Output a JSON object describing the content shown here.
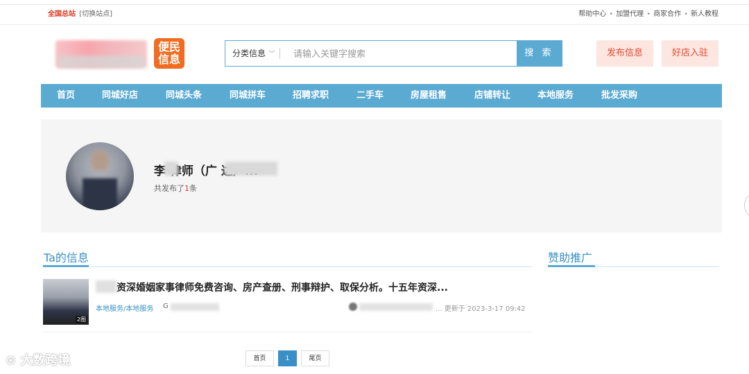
{
  "topbar": {
    "site": "全国总站",
    "switch": "[切换站点]",
    "links": [
      "帮助中心",
      "加盟代理",
      "商家合作",
      "新人教程"
    ]
  },
  "logo": {
    "badge_text": "便民信息"
  },
  "search": {
    "category": "分类信息",
    "placeholder": "请输入关键字搜索",
    "button": "搜 索"
  },
  "actions": {
    "publish": "发布信息",
    "join": "好店入驻"
  },
  "nav": [
    "首页",
    "同城好店",
    "同城头条",
    "同城拼车",
    "招聘求职",
    "二手车",
    "房屋租售",
    "店铺转让",
    "本地服务",
    "批发采购"
  ],
  "profile": {
    "name": "李  律师（广      达）...",
    "count_prefix": "共发布了",
    "count": "1",
    "count_suffix": "条"
  },
  "sections": {
    "my_info": "Ta的信息",
    "sponsor": "赞助推广"
  },
  "post": {
    "title": "资深婚姻家事律师免费咨询、房产查册、刑事辩护、取保分析。十五年资深...",
    "category": "本地服务/本地服务",
    "g_prefix": "G",
    "thumb_badge": "2图",
    "updated": "... 更新于 2023-3-17 09:42"
  },
  "pagination": {
    "first": "首页",
    "current": "1",
    "last": "尾页"
  },
  "watermark": "大数跨境",
  "colors": {
    "accent": "#5aaad2",
    "brand_red": "#e2351e",
    "pill_bg": "#fde6e0"
  }
}
